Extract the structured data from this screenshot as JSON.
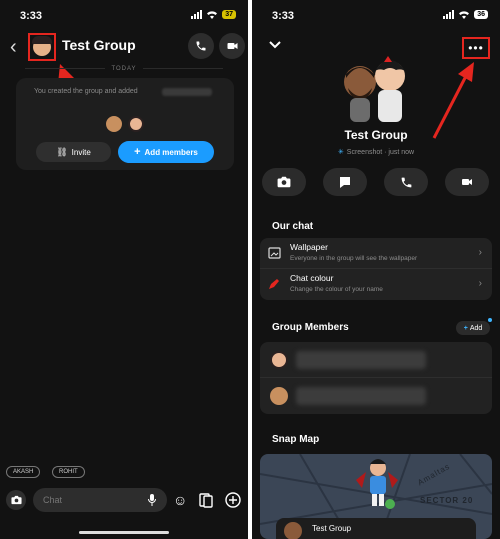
{
  "left_screen": {
    "status": {
      "time": "3:33",
      "battery": "37"
    },
    "header": {
      "title": "Test Group"
    },
    "today_label": "TODAY",
    "created_message": "You created the group and added",
    "buttons": {
      "invite": "Invite",
      "add_members": "Add members"
    },
    "mentions": [
      "AKASH",
      "ROHIT"
    ],
    "input": {
      "placeholder": "Chat"
    }
  },
  "right_screen": {
    "status": {
      "time": "3:33",
      "battery": "36"
    },
    "title": "Test Group",
    "snap_status": "Screenshot · just now",
    "our_chat": {
      "heading": "Our chat",
      "items": [
        {
          "title": "Wallpaper",
          "subtitle": "Everyone in the group will see the wallpaper"
        },
        {
          "title": "Chat colour",
          "subtitle": "Change the colour of your name"
        }
      ]
    },
    "group_members": {
      "heading": "Group Members",
      "add_label": "Add"
    },
    "snap_map": {
      "heading": "Snap Map",
      "labels": [
        "Amaltas",
        "SECTOR 20"
      ],
      "card_name": "Test Group"
    }
  },
  "colors": {
    "accent_blue": "#1b9cff",
    "highlight_red": "#e5261f",
    "background": "#121212"
  }
}
